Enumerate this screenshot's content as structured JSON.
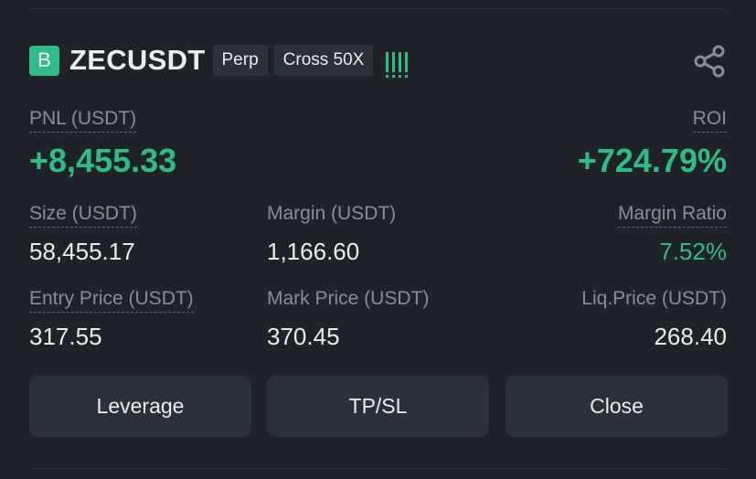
{
  "position": {
    "side_badge": "B",
    "symbol": "ZECUSDT",
    "type_tag": "Perp",
    "margin_tag": "Cross 50X",
    "share_icon": "share-icon",
    "risk_icon": "risk-bars-icon"
  },
  "pnl": {
    "label": "PNL (USDT)",
    "value": "+8,455.33"
  },
  "roi": {
    "label": "ROI",
    "value": "+724.79%"
  },
  "size": {
    "label": "Size (USDT)",
    "value": "58,455.17"
  },
  "margin": {
    "label": "Margin (USDT)",
    "value": "1,166.60"
  },
  "margin_ratio": {
    "label": "Margin Ratio",
    "value": "7.52%"
  },
  "entry_price": {
    "label": "Entry Price (USDT)",
    "value": "317.55"
  },
  "mark_price": {
    "label": "Mark Price (USDT)",
    "value": "370.45"
  },
  "liq_price": {
    "label": "Liq.Price (USDT)",
    "value": "268.40"
  },
  "buttons": {
    "leverage": "Leverage",
    "tpsl": "TP/SL",
    "close": "Close"
  },
  "colors": {
    "background": "#1f2329",
    "positive": "#2ebd85",
    "muted_text": "#848e9c",
    "primary_text": "#eaecef",
    "button_bg": "#2b3139"
  }
}
